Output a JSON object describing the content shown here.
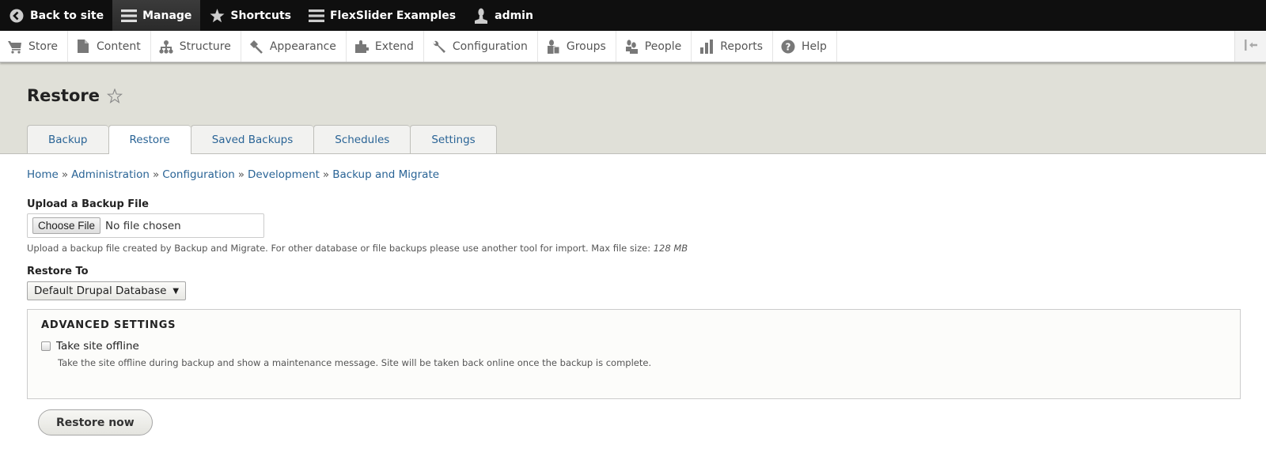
{
  "toolbar": {
    "items": [
      {
        "label": "Back to site",
        "icon": "chevron-left-circle-icon"
      },
      {
        "label": "Manage",
        "icon": "menu-icon",
        "active": true
      },
      {
        "label": "Shortcuts",
        "icon": "star-icon"
      },
      {
        "label": "FlexSlider Examples",
        "icon": "menu-icon"
      },
      {
        "label": "admin",
        "icon": "user-icon"
      }
    ]
  },
  "tray": {
    "items": [
      {
        "label": "Store",
        "icon": "cart-icon"
      },
      {
        "label": "Content",
        "icon": "file-icon"
      },
      {
        "label": "Structure",
        "icon": "sitemap-icon"
      },
      {
        "label": "Appearance",
        "icon": "paintbrush-icon"
      },
      {
        "label": "Extend",
        "icon": "puzzle-icon"
      },
      {
        "label": "Configuration",
        "icon": "wrench-icon"
      },
      {
        "label": "Groups",
        "icon": "groups-icon"
      },
      {
        "label": "People",
        "icon": "people-icon"
      },
      {
        "label": "Reports",
        "icon": "bar-chart-icon"
      },
      {
        "label": "Help",
        "icon": "help-icon"
      }
    ],
    "toggle_icon": "collapse-tray-icon"
  },
  "page": {
    "title": "Restore",
    "tabs": [
      {
        "label": "Backup",
        "active": false
      },
      {
        "label": "Restore",
        "active": true
      },
      {
        "label": "Saved Backups",
        "active": false
      },
      {
        "label": "Schedules",
        "active": false
      },
      {
        "label": "Settings",
        "active": false
      }
    ]
  },
  "breadcrumb": {
    "items": [
      "Home",
      "Administration",
      "Configuration",
      "Development",
      "Backup and Migrate"
    ],
    "separator": "»"
  },
  "form": {
    "upload": {
      "label": "Upload a Backup File",
      "button_label": "Choose File",
      "status": "No file chosen",
      "description": "Upload a backup file created by Backup and Migrate. For other database or file backups please use another tool for import. Max file size:",
      "max_size": "128 MB"
    },
    "restore_to": {
      "label": "Restore To",
      "selected": "Default Drupal Database"
    },
    "advanced": {
      "legend": "ADVANCED SETTINGS",
      "checkbox_label": "Take site offline",
      "checked": false,
      "checkbox_description": "Take the site offline during backup and show a maintenance message. Site will be taken back online once the backup is complete."
    },
    "submit_label": "Restore now"
  }
}
